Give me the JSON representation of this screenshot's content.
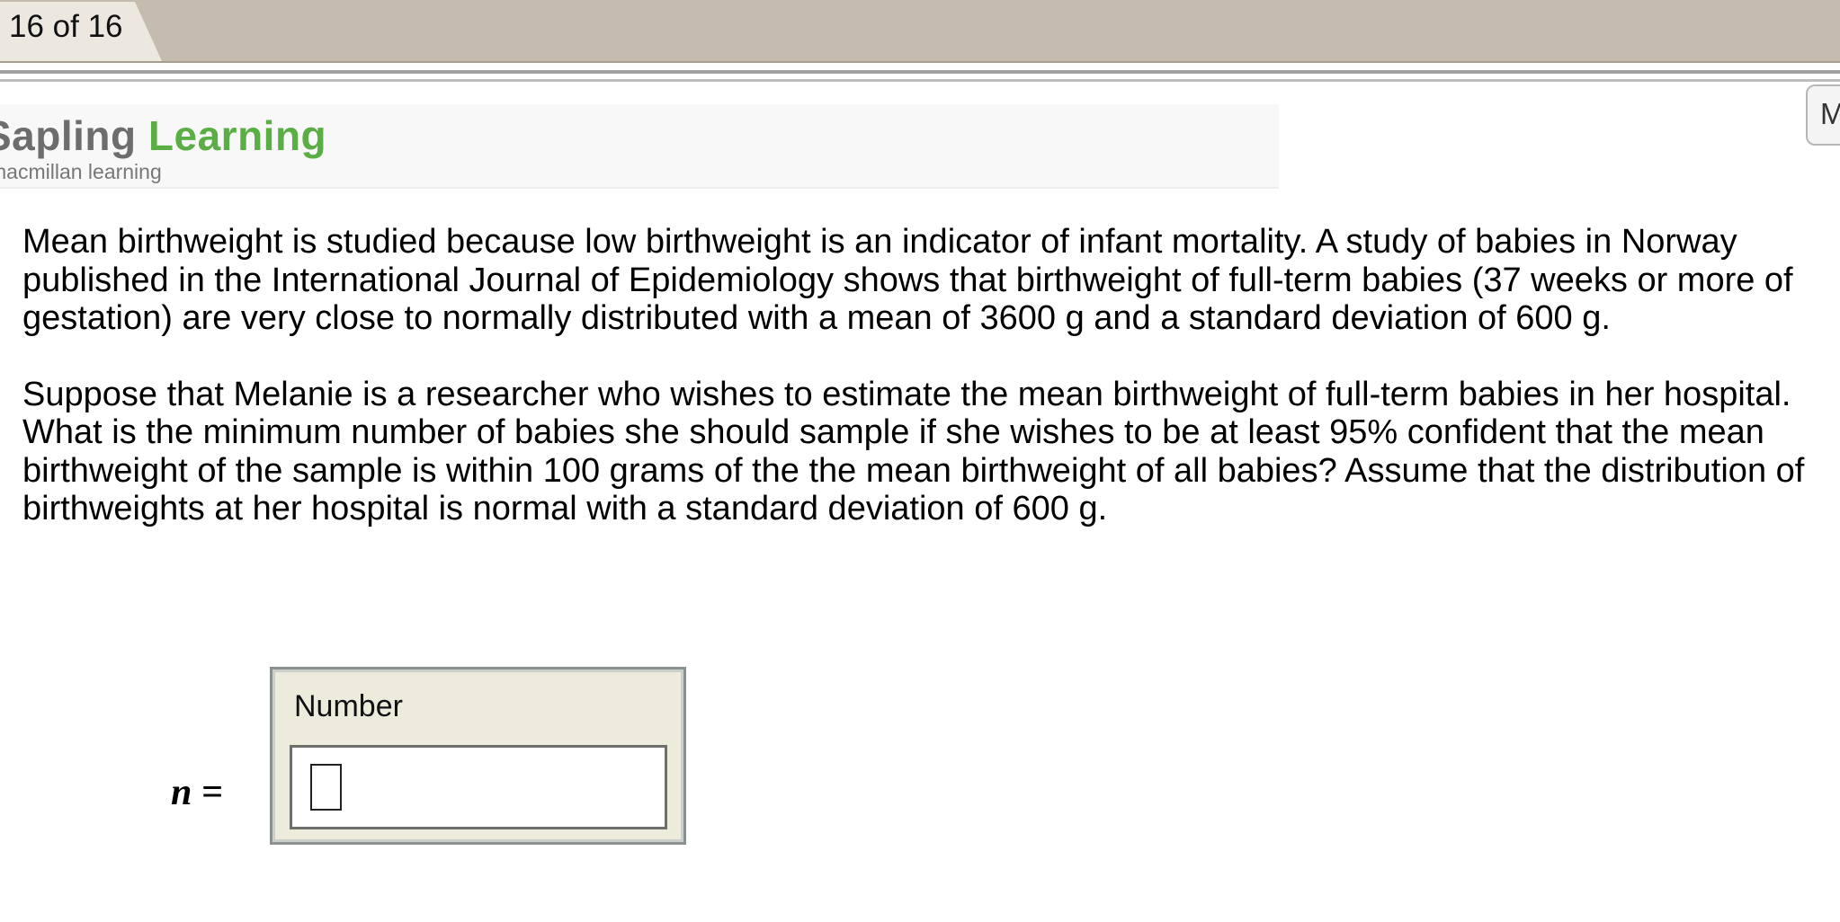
{
  "tab": {
    "label": "16 of 16"
  },
  "right_tab": {
    "label": "M"
  },
  "logo": {
    "part1": "Sapling",
    "part2": "Learning",
    "subtitle": "macmillan learning",
    "colors": {
      "part1": "#6d6d6d",
      "part2": "#5aae45"
    }
  },
  "question": {
    "paragraphs": [
      "Mean birthweight is studied because low birthweight is an indicator of infant mortality. A study of babies in Norway published in the International Journal of Epidemiology shows that birthweight of full-term babies (37 weeks or more of gestation) are very close to normally distributed with a mean of 3600 g and a standard deviation of 600 g.",
      "Suppose that Melanie is a researcher who wishes to estimate the mean birthweight of full-term babies in her hospital. What is the minimum number of babies she should sample if she wishes to be at least 95% confident that the mean birthweight of the sample is within 100 grams of the the mean birthweight of all babies? Assume that the distribution of birthweights at her hospital is normal with a standard deviation of 600 g."
    ]
  },
  "answer": {
    "variable_label": "n =",
    "box_label": "Number",
    "value": ""
  }
}
